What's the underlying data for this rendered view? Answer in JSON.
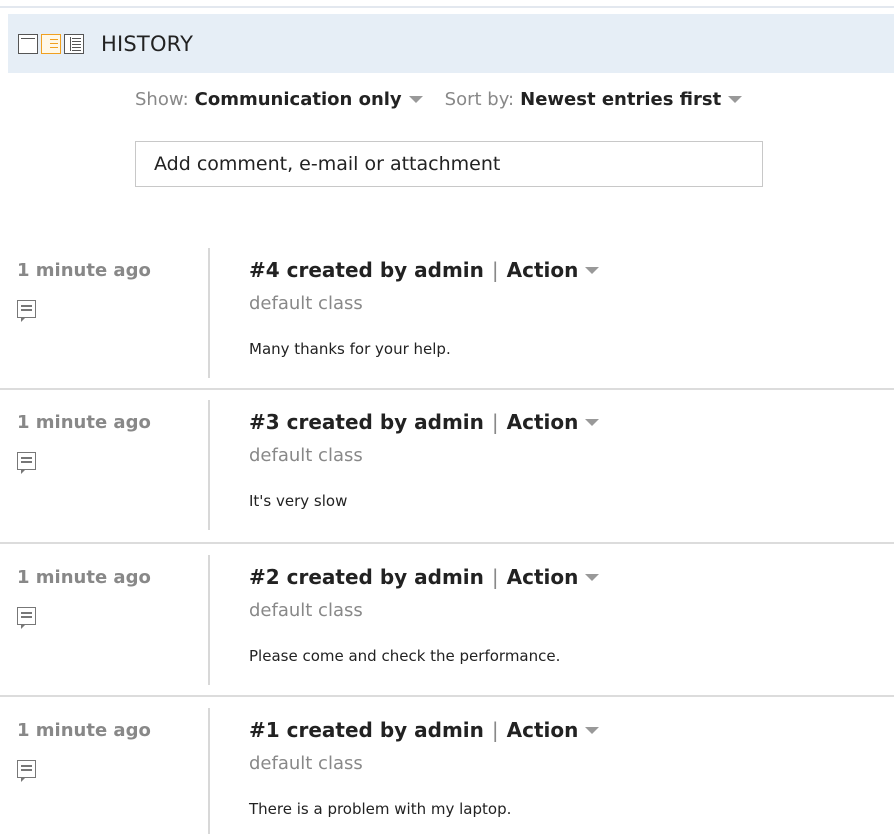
{
  "header": {
    "title": "HISTORY",
    "view_icons": [
      "compact-view-icon",
      "comment-view-icon",
      "detail-view-icon"
    ],
    "active_view": "comment-view-icon"
  },
  "filters": {
    "show_label": "Show:",
    "show_value": "Communication only",
    "sort_label": "Sort by:",
    "sort_value": "Newest entries first"
  },
  "composer": {
    "placeholder": "Add comment, e-mail or attachment"
  },
  "entries": [
    {
      "time": "1 minute ago",
      "title": "#4 created by admin",
      "separator": "|",
      "action": "Action",
      "class": "default class",
      "text": "Many thanks for your help."
    },
    {
      "time": "1 minute ago",
      "title": "#3 created by admin",
      "separator": "|",
      "action": "Action",
      "class": "default class",
      "text": "It's very slow"
    },
    {
      "time": "1 minute ago",
      "title": "#2 created by admin",
      "separator": "|",
      "action": "Action",
      "class": "default class",
      "text": "Please come and check the performance."
    },
    {
      "time": "1 minute ago",
      "title": "#1 created by admin",
      "separator": "|",
      "action": "Action",
      "class": "default class",
      "text": "There is a problem with my laptop."
    }
  ],
  "colors": {
    "header_bg": "#e6eef6",
    "active_icon": "#f0a020",
    "muted_text": "#888888"
  }
}
